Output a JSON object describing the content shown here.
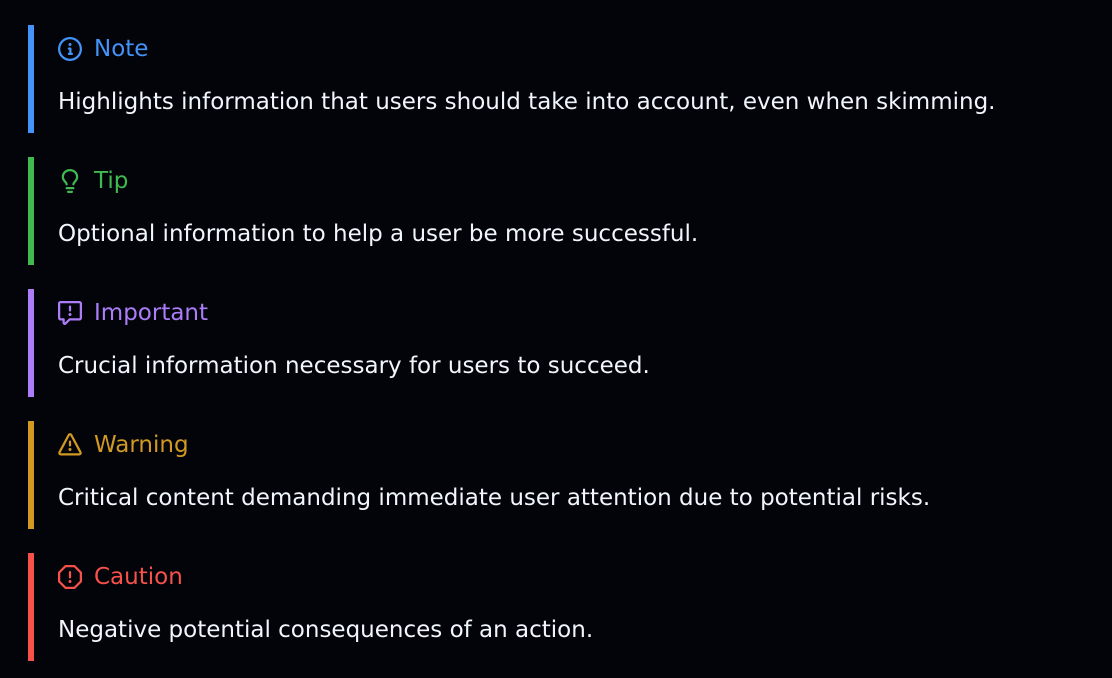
{
  "alerts": [
    {
      "kind": "note",
      "title": "Note",
      "icon": "info-icon",
      "color": "#4493f8",
      "body": "Highlights information that users should take into account, even when skimming."
    },
    {
      "kind": "tip",
      "title": "Tip",
      "icon": "light-bulb-icon",
      "color": "#3fb950",
      "body": "Optional information to help a user be more successful."
    },
    {
      "kind": "important",
      "title": "Important",
      "icon": "report-icon",
      "color": "#ab7df8",
      "body": "Crucial information necessary for users to succeed."
    },
    {
      "kind": "warning",
      "title": "Warning",
      "icon": "alert-triangle-icon",
      "color": "#d29922",
      "body": "Critical content demanding immediate user attention due to potential risks."
    },
    {
      "kind": "caution",
      "title": "Caution",
      "icon": "stop-icon",
      "color": "#f85149",
      "body": "Negative potential consequences of an action."
    }
  ]
}
